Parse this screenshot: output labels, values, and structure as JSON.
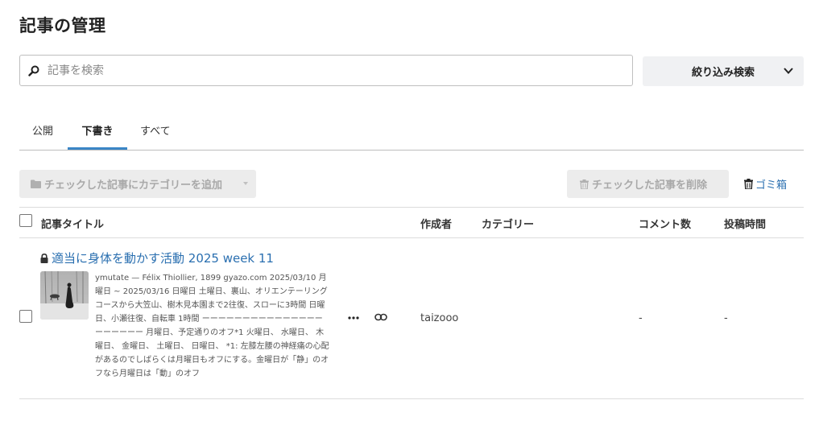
{
  "page": {
    "title": "記事の管理"
  },
  "search": {
    "placeholder": "記事を検索"
  },
  "filter": {
    "label": "絞り込み検索"
  },
  "tabs": [
    {
      "label": "公開",
      "active": false
    },
    {
      "label": "下書き",
      "active": true
    },
    {
      "label": "すべて",
      "active": false
    }
  ],
  "actions": {
    "add_category_label": "チェックした記事にカテゴリーを追加",
    "delete_label": "チェックした記事を削除",
    "trash_label": "ゴミ箱"
  },
  "table": {
    "headers": {
      "title": "記事タイトル",
      "author": "作成者",
      "category": "カテゴリー",
      "comments": "コメント数",
      "posted": "投稿時間"
    },
    "rows": [
      {
        "title": "適当に身体を動かす活動 2025 week 11",
        "locked": true,
        "excerpt": "ymutate — Félix Thiollier, 1899 gyazo.com 2025/03/10 月曜日 ~ 2025/03/16 日曜日 土曜日、裏山、オリエンテーリングコースから大笠山、樹木見本園まで2往復、スローに3時間 日曜日、小瀬往復、自転車 1時間 ーーーーーーーーーーーーーーーーーーーーー 月曜日、予定通りのオフ*1 火曜日、 水曜日、 木曜日、 金曜日、 土曜日、 日曜日、 *1: 左膝左腰の神経痛の心配があるのでしばらくは月曜日もオフにする。金曜日が「静」のオフなら月曜日は「動」のオフ",
        "author": "taizooo",
        "category": "",
        "comments": "-",
        "posted": "-"
      }
    ]
  },
  "colors": {
    "link": "#2a6fb0",
    "tab_accent": "#3a86c6",
    "button_bg": "#f0f1f3",
    "disabled_bg": "#ececec"
  },
  "icons": [
    "search-icon",
    "chevron-down-icon",
    "folder-icon",
    "trash-icon",
    "lock-icon",
    "more-horizontal-icon",
    "link-icon"
  ]
}
